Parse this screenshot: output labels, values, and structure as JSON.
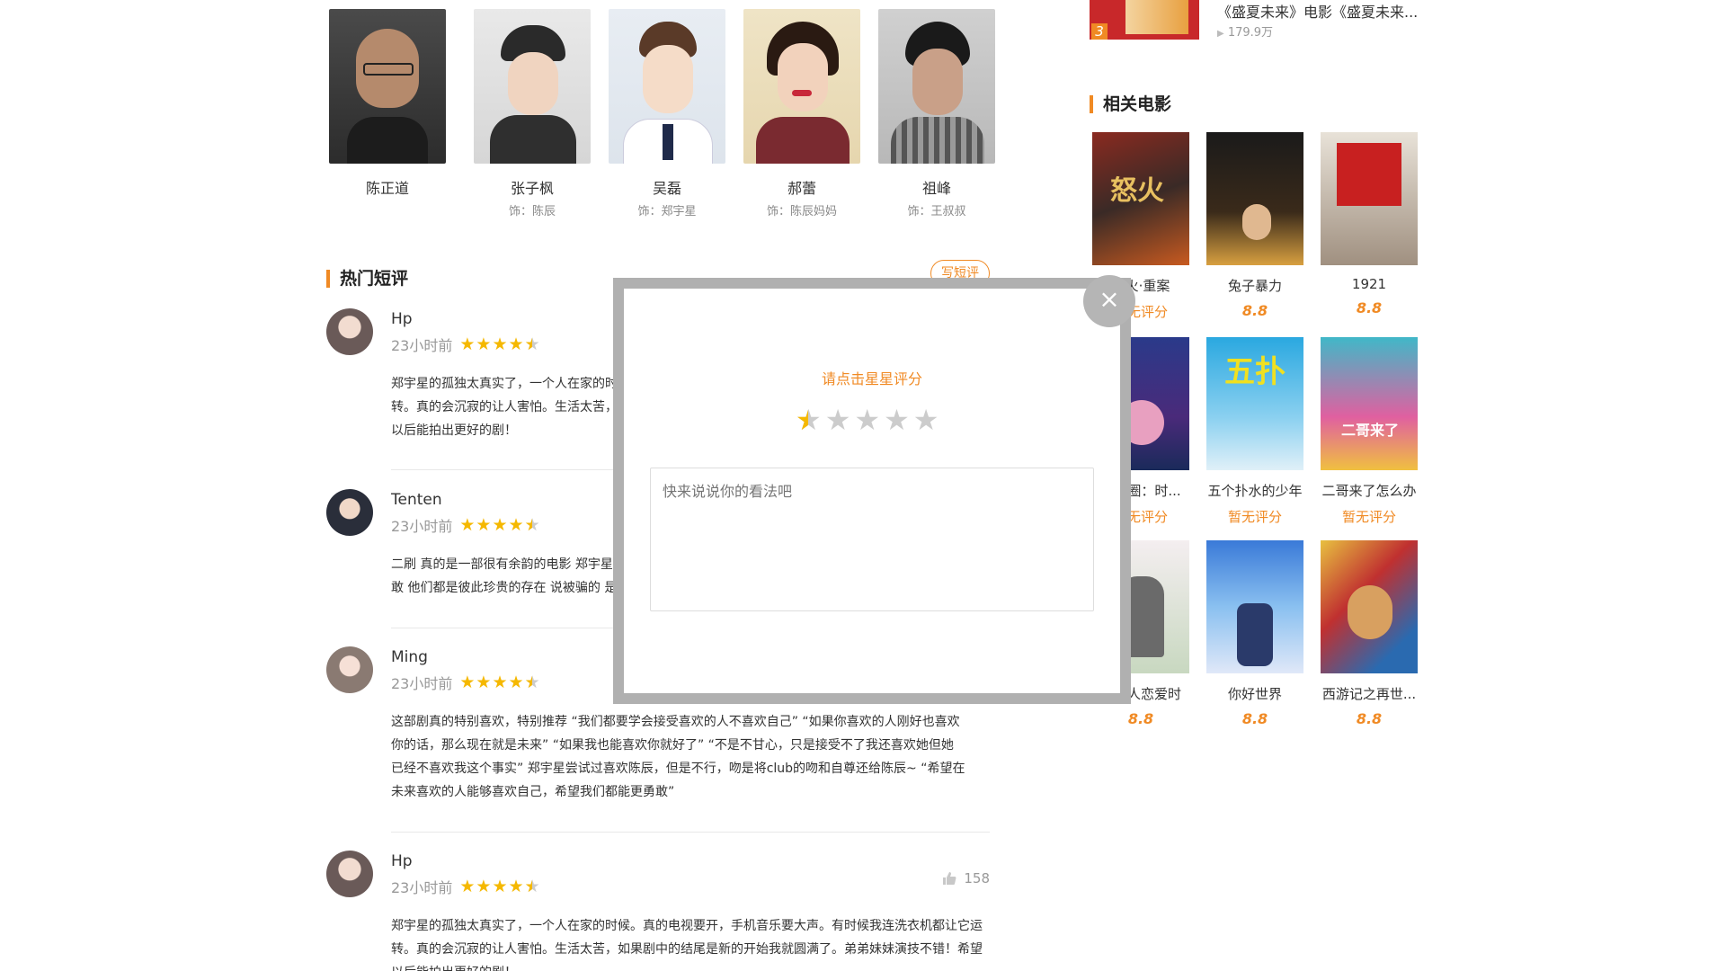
{
  "cast": [
    {
      "name": "陈正道",
      "role": ""
    },
    {
      "name": "张子枫",
      "role": "饰：陈辰"
    },
    {
      "name": "吴磊",
      "role": "饰：郑宇星"
    },
    {
      "name": "郝蕾",
      "role": "饰：陈辰妈妈"
    },
    {
      "name": "祖峰",
      "role": "饰：王叔叔"
    }
  ],
  "comments_section": {
    "title": "热门短评",
    "write_button": "写短评"
  },
  "comments": [
    {
      "user": "Hp",
      "time": "23小时前",
      "rating": 4.5,
      "lines": [
        "郑宇星的孤独太真实了，一个人在家的时候。真的电视要开，手机音乐要大声。有时候我连洗衣机都让它运",
        "转。真的会沉寂的让人害怕。生活太苦，如果剧中的结尾是新的开始我就圆满了。弟弟妹妹演技不错！希望",
        "以后能拍出更好的剧！"
      ],
      "likes": ""
    },
    {
      "user": "Tenten",
      "time": "23小时前",
      "rating": 4.5,
      "lines": [
        "二刷 真的是一部很有余韵的电影 郑宇星和陈辰 他们在彼此的世界里找到了光 慢慢学会了面对 慢慢变得勇",
        "敢 他们都是彼此珍贵的存在 说被骗的 是没有看懂电影想表达的东西吧"
      ],
      "likes": ""
    },
    {
      "user": "Ming",
      "time": "23小时前",
      "rating": 4.5,
      "lines": [
        "这部剧真的特别喜欢，特别推荐 “我们都要学会接受喜欢的人不喜欢自己” “如果你喜欢的人刚好也喜欢",
        "你的话，那么现在就是未来” “如果我也能喜欢你就好了” “不是不甘心，只是接受不了我还喜欢她但她",
        "已经不喜欢我这个事实” 郑宇星尝试过喜欢陈辰，但是不行，吻是将club的吻和自尊还给陈辰~ “希望在",
        "未来喜欢的人能够喜欢自己，希望我们都能更勇敢”"
      ],
      "likes": ""
    },
    {
      "user": "Hp",
      "time": "23小时前",
      "rating": 4.5,
      "lines": [
        "郑宇星的孤独太真实了，一个人在家的时候。真的电视要开，手机音乐要大声。有时候我连洗衣机都让它运",
        "转。真的会沉寂的让人害怕。生活太苦，如果剧中的结尾是新的开始我就圆满了。弟弟妹妹演技不错！希望",
        "以后能拍出更好的剧！"
      ],
      "likes": "158"
    }
  ],
  "rank_item": {
    "num": "3",
    "title": "《盛夏未来》电影《盛夏未来...",
    "plays": "179.9万"
  },
  "related": {
    "title": "相关电影",
    "movies": [
      {
        "title": "怒火·重案",
        "score": "暂无评分",
        "has_score": false
      },
      {
        "title": "兔子暴力",
        "score": "8.8",
        "has_score": true
      },
      {
        "title": "1921",
        "score": "8.8",
        "has_score": true
      },
      {
        "title": "甜甜圈：时...",
        "score": "暂无评分",
        "has_score": false
      },
      {
        "title": "五个扑水的少年",
        "score": "暂无评分",
        "has_score": false
      },
      {
        "title": "二哥来了怎么办",
        "score": "暂无评分",
        "has_score": false
      },
      {
        "title": "当男人恋爱时",
        "score": "8.8",
        "has_score": true
      },
      {
        "title": "你好世界",
        "score": "8.8",
        "has_score": true
      },
      {
        "title": "西游记之再世...",
        "score": "8.8",
        "has_score": true
      }
    ]
  },
  "modal": {
    "prompt": "请点击星星评分",
    "rating": 0.5,
    "placeholder": "快来说说你的看法吧",
    "close": "×"
  },
  "colors": {
    "accent": "#f08a24",
    "star": "#f5b800"
  }
}
